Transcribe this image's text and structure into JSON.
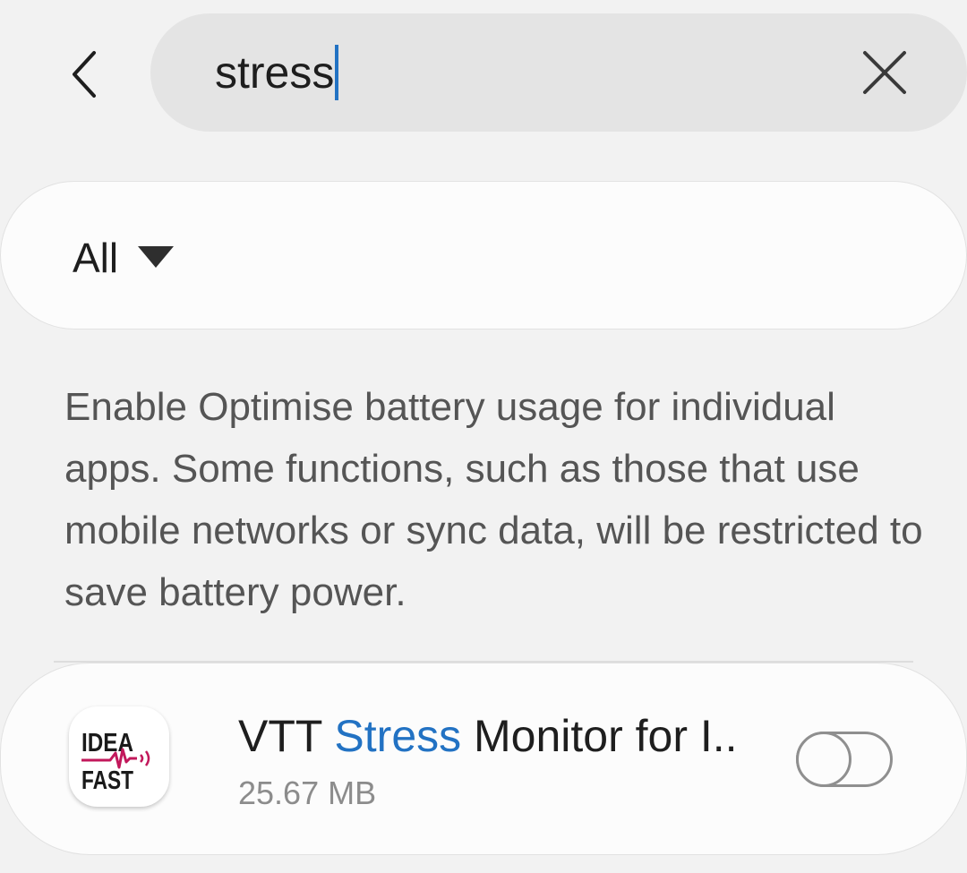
{
  "search": {
    "query": "stress"
  },
  "filter": {
    "selected": "All"
  },
  "description": "Enable Optimise battery usage for individual apps. Some functions, such as those that use mobile networks or sync data, will be restricted to save battery power.",
  "apps": [
    {
      "name_prefix": "VTT ",
      "name_highlight": "Stress",
      "name_suffix": " Monitor for I..",
      "size": "25.67 MB",
      "icon": {
        "line1": "IDEA",
        "line2": "FAST",
        "accent_color": "#c2185b"
      },
      "optimise_enabled": false
    }
  ],
  "colors": {
    "background": "#f2f2f2",
    "card": "#fcfcfc",
    "search_box": "#e4e4e4",
    "highlight": "#2272c3",
    "caret": "#2272c3",
    "text_primary": "#1e1e1e",
    "text_secondary": "#555555",
    "text_tertiary": "#8c8c8c",
    "toggle_off": "#8f8f8f"
  }
}
